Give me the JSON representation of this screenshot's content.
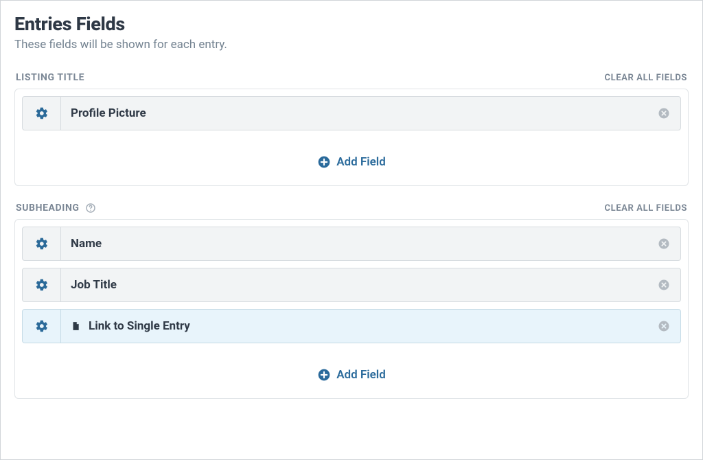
{
  "page": {
    "title": "Entries Fields",
    "subtitle": "These fields will be shown for each entry."
  },
  "sections": {
    "listing_title": {
      "label": "LISTING TITLE",
      "clear_label": "CLEAR ALL FIELDS",
      "add_label": "Add Field",
      "fields": [
        {
          "label": "Profile Picture"
        }
      ]
    },
    "subheading": {
      "label": "SUBHEADING",
      "clear_label": "CLEAR ALL FIELDS",
      "add_label": "Add Field",
      "fields": [
        {
          "label": "Name"
        },
        {
          "label": "Job Title"
        },
        {
          "label": "Link to Single Entry",
          "icon": "file",
          "highlight": true
        }
      ]
    }
  }
}
